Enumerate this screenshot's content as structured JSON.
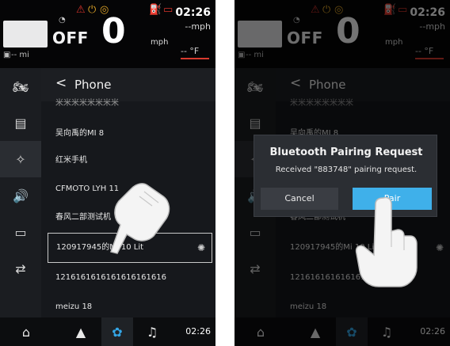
{
  "header": {
    "time": "02:26",
    "speed_unit_top": "--mph",
    "gear_state": "OFF",
    "speed": "0",
    "speed_unit": "mph",
    "range": "-- mi",
    "temperature": "-- °F"
  },
  "phone": {
    "title": "Phone",
    "devices": [
      {
        "name": "米米米米米米米米"
      },
      {
        "name": "吴向禹的MI 8"
      },
      {
        "name": "红米手机"
      },
      {
        "name": "CFMOTO LYH 11"
      },
      {
        "name": "春风二部测试机"
      },
      {
        "name": "120917945的Mi 10 Lit"
      },
      {
        "name": "1216161616161616161616"
      },
      {
        "name": "meizu 18"
      }
    ]
  },
  "footer": {
    "time": "02:26"
  },
  "dialog": {
    "title": "Bluetooth Pairing Request",
    "message": "Received \"883748\" pairing request.",
    "cancel_label": "Cancel",
    "pair_label": "Pair"
  },
  "colors": {
    "accent": "#3fb0ea",
    "warning_red": "#d6342b",
    "warning_amber": "#dba126"
  },
  "icons": [
    "motorcycle-icon",
    "dashboard-icon",
    "bluetooth-icon",
    "speaker-icon",
    "display-icon",
    "sliders-icon",
    "home-icon",
    "navigation-icon",
    "settings-icon",
    "music-icon"
  ]
}
